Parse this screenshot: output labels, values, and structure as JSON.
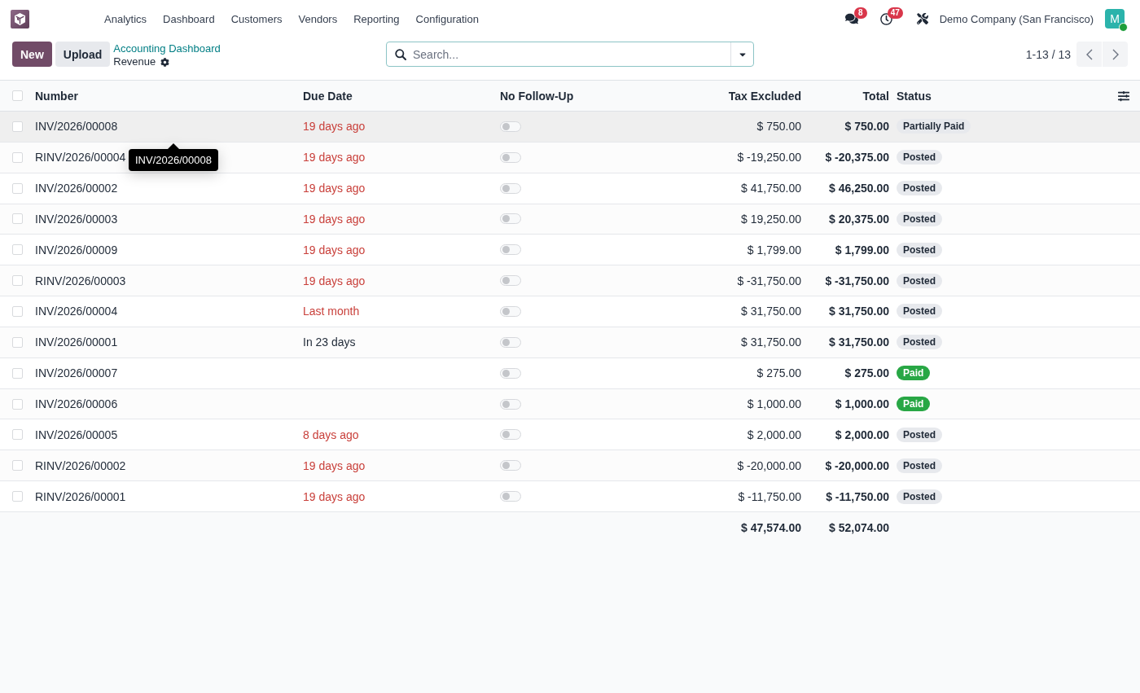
{
  "navbar": {
    "menu": [
      "Analytics",
      "Dashboard",
      "Customers",
      "Vendors",
      "Reporting",
      "Configuration"
    ],
    "messages_count": "8",
    "activities_count": "47",
    "company": "Demo Company (San Francisco)",
    "avatar_initial": "M",
    "online": true
  },
  "control_panel": {
    "buttons": [
      {
        "label": "New",
        "kind": "primary"
      },
      {
        "label": "Upload",
        "kind": "secondary"
      }
    ],
    "breadcrumb": "Accounting Dashboard",
    "title": "Revenue",
    "search": {
      "placeholder": "Search..."
    },
    "pager": "1-13 / 13"
  },
  "table": {
    "all_checked": false,
    "columns": [
      "Number",
      "Due Date",
      "No Follow-Up",
      "Tax Excluded",
      "Total",
      "Status"
    ],
    "rows": [
      {
        "number": "INV/2026/00008",
        "due_date": "19 days ago",
        "overdue": true,
        "no_follow_up": false,
        "tax_excluded": "$ 750.00",
        "total": "$ 750.00",
        "status": {
          "label": "Partially Paid",
          "kind": "muted"
        },
        "checked": false,
        "hovered": true
      },
      {
        "number": "RINV/2026/00004",
        "due_date": "19 days ago",
        "overdue": true,
        "no_follow_up": false,
        "tax_excluded": "$ -19,250.00",
        "total": "$ -20,375.00",
        "status": {
          "label": "Posted",
          "kind": "muted"
        },
        "checked": false,
        "hovered": false
      },
      {
        "number": "INV/2026/00002",
        "due_date": "19 days ago",
        "overdue": true,
        "no_follow_up": false,
        "tax_excluded": "$ 41,750.00",
        "total": "$ 46,250.00",
        "status": {
          "label": "Posted",
          "kind": "muted"
        },
        "checked": false,
        "hovered": false
      },
      {
        "number": "INV/2026/00003",
        "due_date": "19 days ago",
        "overdue": true,
        "no_follow_up": false,
        "tax_excluded": "$ 19,250.00",
        "total": "$ 20,375.00",
        "status": {
          "label": "Posted",
          "kind": "muted"
        },
        "checked": false,
        "hovered": false
      },
      {
        "number": "INV/2026/00009",
        "due_date": "19 days ago",
        "overdue": true,
        "no_follow_up": false,
        "tax_excluded": "$ 1,799.00",
        "total": "$ 1,799.00",
        "status": {
          "label": "Posted",
          "kind": "muted"
        },
        "checked": false,
        "hovered": false
      },
      {
        "number": "RINV/2026/00003",
        "due_date": "19 days ago",
        "overdue": true,
        "no_follow_up": false,
        "tax_excluded": "$ -31,750.00",
        "total": "$ -31,750.00",
        "status": {
          "label": "Posted",
          "kind": "muted"
        },
        "checked": false,
        "hovered": false
      },
      {
        "number": "INV/2026/00004",
        "due_date": "Last month",
        "overdue": true,
        "no_follow_up": false,
        "tax_excluded": "$ 31,750.00",
        "total": "$ 31,750.00",
        "status": {
          "label": "Posted",
          "kind": "muted"
        },
        "checked": false,
        "hovered": false
      },
      {
        "number": "INV/2026/00001",
        "due_date": "In 23 days",
        "overdue": false,
        "no_follow_up": false,
        "tax_excluded": "$ 31,750.00",
        "total": "$ 31,750.00",
        "status": {
          "label": "Posted",
          "kind": "muted"
        },
        "checked": false,
        "hovered": false
      },
      {
        "number": "INV/2026/00007",
        "no_follow_up": false,
        "tax_excluded": "$ 275.00",
        "total": "$ 275.00",
        "status": {
          "label": "Paid",
          "kind": "success"
        },
        "checked": false,
        "hovered": false
      },
      {
        "number": "INV/2026/00006",
        "no_follow_up": false,
        "tax_excluded": "$ 1,000.00",
        "total": "$ 1,000.00",
        "status": {
          "label": "Paid",
          "kind": "success"
        },
        "checked": false,
        "hovered": false
      },
      {
        "number": "INV/2026/00005",
        "due_date": "8 days ago",
        "overdue": true,
        "no_follow_up": false,
        "tax_excluded": "$ 2,000.00",
        "total": "$ 2,000.00",
        "status": {
          "label": "Posted",
          "kind": "muted"
        },
        "checked": false,
        "hovered": false
      },
      {
        "number": "RINV/2026/00002",
        "due_date": "19 days ago",
        "overdue": true,
        "no_follow_up": false,
        "tax_excluded": "$ -20,000.00",
        "total": "$ -20,000.00",
        "status": {
          "label": "Posted",
          "kind": "muted"
        },
        "checked": false,
        "hovered": false
      },
      {
        "number": "RINV/2026/00001",
        "due_date": "19 days ago",
        "overdue": true,
        "no_follow_up": false,
        "tax_excluded": "$ -11,750.00",
        "total": "$ -11,750.00",
        "status": {
          "label": "Posted",
          "kind": "muted"
        },
        "checked": false,
        "hovered": false
      }
    ],
    "totals": {
      "tax_excluded": "$ 47,574.00",
      "total": "$ 52,074.00"
    }
  },
  "tooltip": {
    "text": "INV/2026/00008"
  }
}
